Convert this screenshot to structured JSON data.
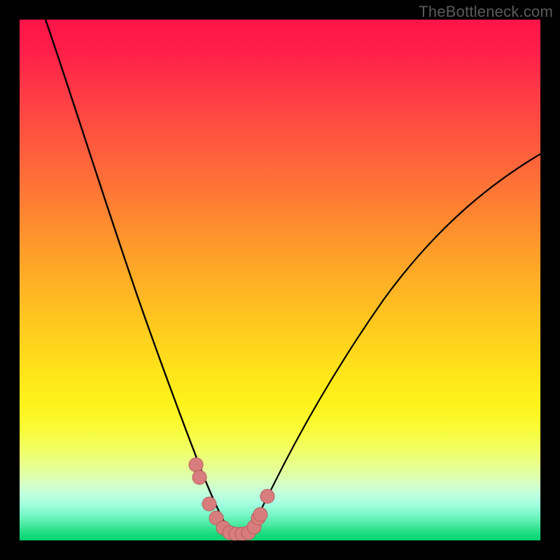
{
  "watermark": "TheBottleneck.com",
  "colors": {
    "background": "#000000",
    "curve": "#000000",
    "marker_fill": "#d77d7d",
    "marker_stroke": "#b85a5a"
  },
  "chart_data": {
    "type": "line",
    "title": "",
    "xlabel": "",
    "ylabel": "",
    "xlim": [
      0,
      100
    ],
    "ylim": [
      0,
      100
    ],
    "grid": false,
    "legend": false,
    "note": "No numeric axis labels are visible; x/y are normalized 0–100 left→right, bottom→top based on plot-area pixels. Values are pixel-read estimates.",
    "series": [
      {
        "name": "left-curve",
        "x": [
          5,
          9,
          14,
          18,
          22,
          26,
          29,
          32,
          34,
          36,
          37.5,
          38.8,
          39.8,
          40.5
        ],
        "y": [
          100,
          90,
          78,
          66,
          54,
          42,
          32,
          23,
          16,
          10,
          6.5,
          4,
          2.3,
          1.5
        ]
      },
      {
        "name": "right-curve",
        "x": [
          44,
          45.5,
          47.5,
          50,
          53,
          57,
          62,
          68,
          75,
          83,
          91,
          100
        ],
        "y": [
          1.5,
          3,
          6,
          10,
          15,
          22,
          31,
          40,
          50,
          59,
          67,
          74
        ]
      },
      {
        "name": "valley-markers",
        "x": [
          33.9,
          34.6,
          36.4,
          37.8,
          39.1,
          40.3,
          41.5,
          42.7,
          43.9,
          45.0,
          45.8,
          46.2,
          47.6
        ],
        "y": [
          14.5,
          12.1,
          7.0,
          4.3,
          2.4,
          1.5,
          1.2,
          1.2,
          1.5,
          2.6,
          4.3,
          5.0,
          8.5
        ]
      }
    ]
  }
}
